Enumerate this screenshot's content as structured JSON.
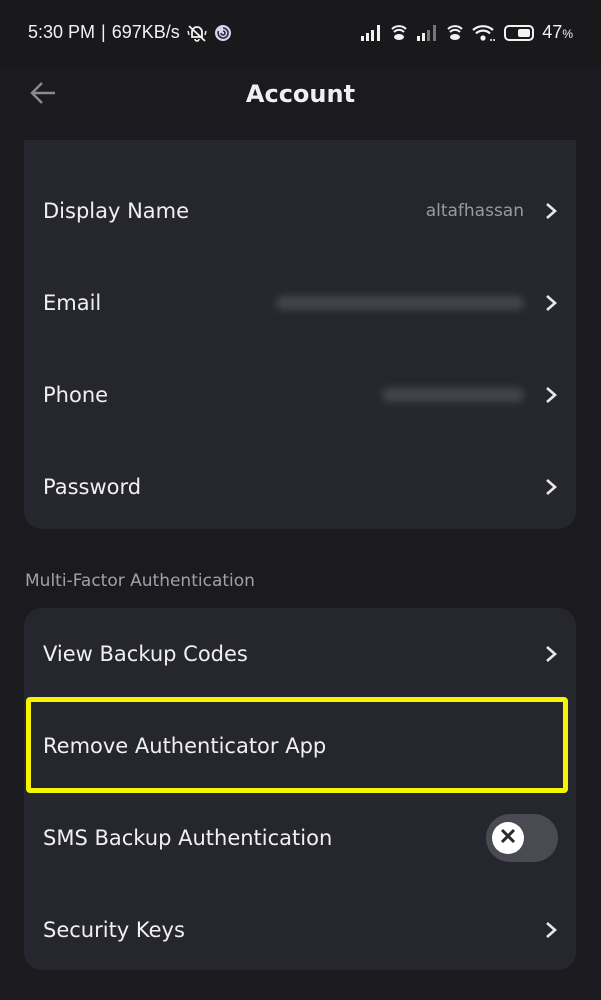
{
  "status_bar": {
    "time": "5:30 PM",
    "separator": "|",
    "network_speed": "697KB/s",
    "battery_percent": "47",
    "battery_level": 0.47,
    "percent_sign": "%",
    "icons": [
      "notifications-muted-icon",
      "app-notification-icon",
      "signal-sim1-icon",
      "hotspot-icon",
      "signal-sim2-icon",
      "hotspot-icon",
      "wifi-icon",
      "battery-icon"
    ]
  },
  "header": {
    "title": "Account",
    "back_icon": "arrow-left-icon"
  },
  "account_section": {
    "items": [
      {
        "label": "Display Name",
        "value": "altafhassan",
        "value_state": "visible",
        "action": "chevron-right-icon"
      },
      {
        "label": "Email",
        "value": "",
        "value_state": "blurred",
        "action": "chevron-right-icon"
      },
      {
        "label": "Phone",
        "value": "",
        "value_state": "blurred",
        "action": "chevron-right-icon"
      },
      {
        "label": "Password",
        "value": "",
        "value_state": "none",
        "action": "chevron-right-icon"
      }
    ]
  },
  "mfa_section": {
    "heading": "Multi-Factor Authentication",
    "items": [
      {
        "label": "View Backup Codes",
        "action": "chevron-right-icon"
      },
      {
        "label": "Remove Authenticator App",
        "action": "none",
        "highlighted": true
      },
      {
        "label": "SMS Backup Authentication",
        "action": "toggle",
        "toggle_on": false
      },
      {
        "label": "Security Keys",
        "action": "chevron-right-icon"
      }
    ]
  },
  "colors": {
    "background": "#1b1b1f",
    "card": "#26262e",
    "highlight": "#f5f500",
    "text_primary": "#f0f0f2",
    "text_secondary": "#9a9aa2",
    "toggle_off_track": "#4a4b52"
  }
}
